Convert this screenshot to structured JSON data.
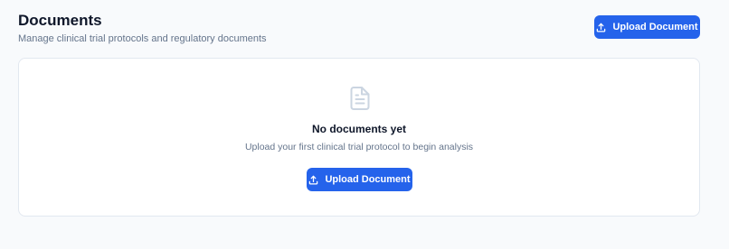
{
  "header": {
    "title": "Documents",
    "subtitle": "Manage clinical trial protocols and regulatory documents",
    "upload_button_label": "Upload Document",
    "upload_button_icon": "upload-icon"
  },
  "empty_state": {
    "icon": "document-icon",
    "title": "No documents yet",
    "description": "Upload your first clinical trial protocol to begin analysis",
    "upload_button_label": "Upload Document",
    "upload_button_icon": "upload-icon"
  },
  "colors": {
    "accent": "#2563eb",
    "background": "#f8fafc",
    "card": "#ffffff",
    "border": "#e2e8f0",
    "muted_text": "#64748b",
    "icon_gray": "#cbd5e1"
  }
}
